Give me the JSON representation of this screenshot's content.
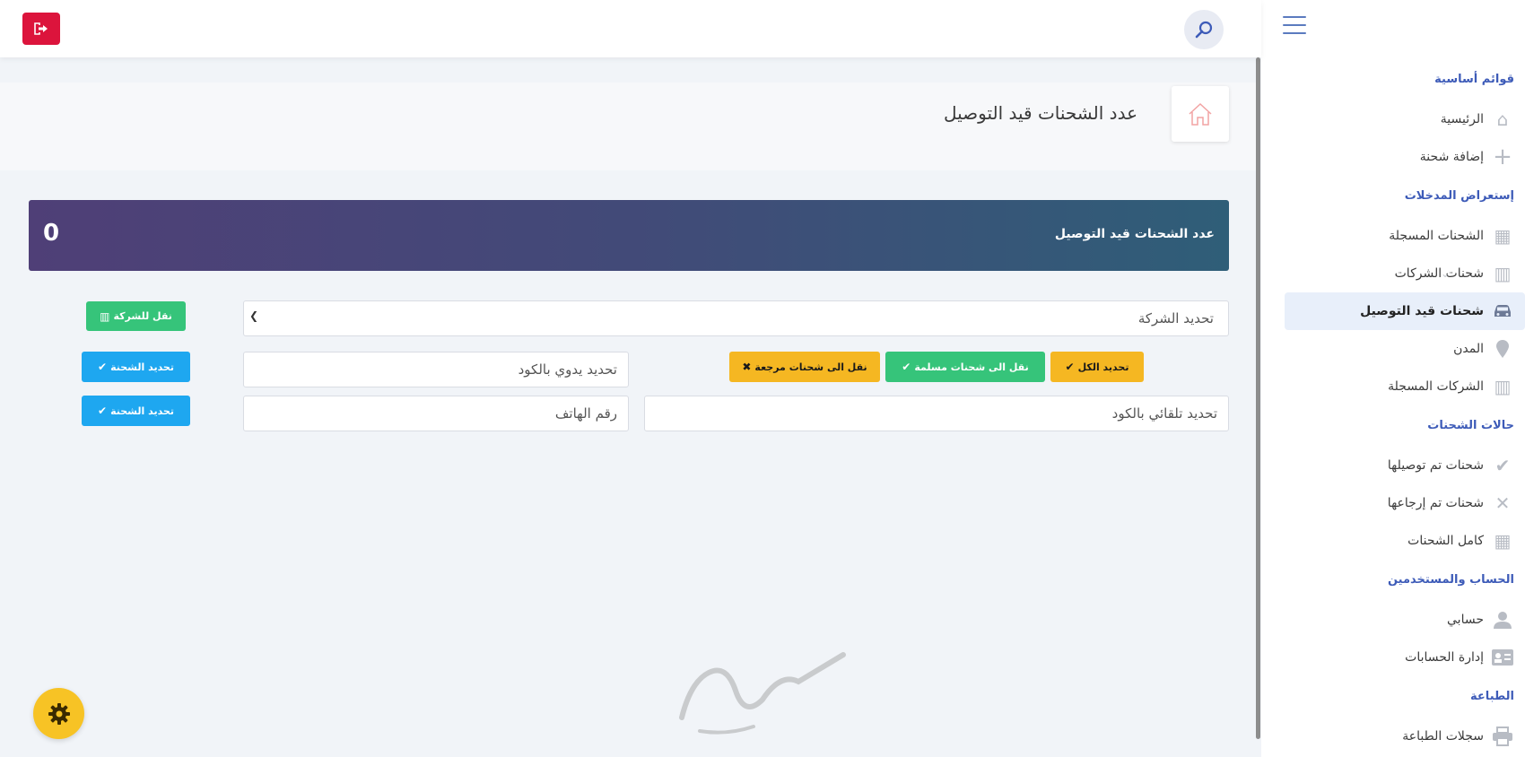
{
  "page": {
    "title": "عدد الشحنات قيد التوصيل"
  },
  "banner": {
    "label": "عدد الشحنات قيد التوصيل",
    "value": "0",
    "gradient": [
      "#4f3f77",
      "#2f5e78"
    ]
  },
  "sidebar": {
    "sections": [
      {
        "title": "قوائم أساسية",
        "items": [
          {
            "label": "الرئيسية",
            "icon": "home-icon"
          },
          {
            "label": "إضافة شحنة",
            "icon": "plus-icon"
          }
        ]
      },
      {
        "title": "إستعراض المدخلات",
        "items": [
          {
            "label": "الشحنات المسجلة",
            "icon": "grid-icon"
          },
          {
            "label": "شحنات الشركات",
            "icon": "building-icon"
          },
          {
            "label": "شحنات قيد التوصيل",
            "icon": "car-icon",
            "active": true
          },
          {
            "label": "المدن",
            "icon": "map-pin-icon"
          },
          {
            "label": "الشركات المسجلة",
            "icon": "building-icon"
          }
        ]
      },
      {
        "title": "حالات الشحنات",
        "items": [
          {
            "label": "شحنات تم توصيلها",
            "icon": "check-icon"
          },
          {
            "label": "شحنات تم إرجاعها",
            "icon": "close-icon"
          },
          {
            "label": "كامل الشحنات",
            "icon": "grid-icon"
          }
        ]
      },
      {
        "title": "الحساب والمستخدمين",
        "items": [
          {
            "label": "حسابي",
            "icon": "user-icon"
          },
          {
            "label": "إدارة الحسابات",
            "icon": "id-card-icon"
          }
        ]
      },
      {
        "title": "الطباعة",
        "items": [
          {
            "label": "سجلات الطباعة",
            "icon": "printer-icon"
          }
        ]
      }
    ]
  },
  "form": {
    "company_select": "تحديد الشركة",
    "move_to_company": "نقل للشركة",
    "select_all": "تحديد الكل",
    "move_delivered": "نقل الى شحنات مسلمة",
    "move_returned": "نقل الى شحنات مرجعة",
    "manual_code_placeholder": "تحديد يدوي بالكود",
    "phone_placeholder": "رقم الهاتف",
    "auto_code_placeholder": "تحديد تلقائي بالكود",
    "select_shipment": "تحديد الشحنة",
    "select_shipment_2": "تحديد الشحنة"
  },
  "colors": {
    "accent": "#3d5bb8",
    "logout": "#dc143c",
    "green": "#36c47a",
    "yellow": "#f5b722",
    "blue": "#1ea7f0",
    "fab": "#f7c325"
  }
}
